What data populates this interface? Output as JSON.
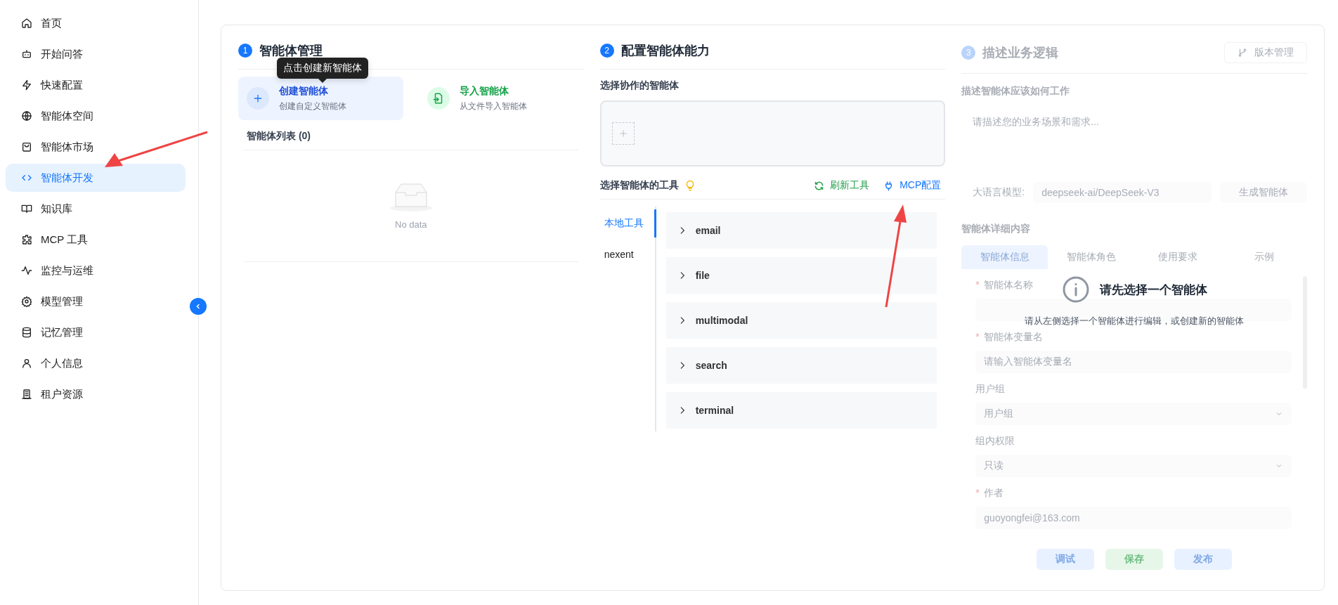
{
  "sidebar": {
    "items": [
      {
        "label": "首页",
        "selected": false
      },
      {
        "label": "开始问答",
        "selected": false
      },
      {
        "label": "快速配置",
        "selected": false
      },
      {
        "label": "智能体空间",
        "selected": false
      },
      {
        "label": "智能体市场",
        "selected": false
      },
      {
        "label": "智能体开发",
        "selected": true
      },
      {
        "label": "知识库",
        "selected": false
      },
      {
        "label": "MCP 工具",
        "selected": false
      },
      {
        "label": "监控与运维",
        "selected": false
      },
      {
        "label": "模型管理",
        "selected": false
      },
      {
        "label": "记忆管理",
        "selected": false
      },
      {
        "label": "个人信息",
        "selected": false
      },
      {
        "label": "租户资源",
        "selected": false
      }
    ]
  },
  "agent_management": {
    "step": "1",
    "title": "智能体管理",
    "tooltip": "点击创建新智能体",
    "actions": [
      {
        "title": "创建智能体",
        "subtitle": "创建自定义智能体",
        "kind": "create",
        "highlighted": true
      },
      {
        "title": "导入智能体",
        "subtitle": "从文件导入智能体",
        "kind": "import",
        "highlighted": false
      }
    ],
    "list_title": "智能体列表 (0)",
    "empty_text": "No data"
  },
  "capabilities": {
    "step": "2",
    "title": "配置智能体能力",
    "collaborators_label": "选择协作的智能体",
    "tools_label": "选择智能体的工具",
    "refresh_button": "刷新工具",
    "mcp_button": "MCP配置",
    "tool_tabs": [
      {
        "label": "本地工具",
        "selected": true
      },
      {
        "label": "nexent",
        "selected": false
      }
    ],
    "tools": [
      {
        "name": "email",
        "expanded": false
      },
      {
        "name": "file",
        "expanded": false
      },
      {
        "name": "multimodal",
        "expanded": false
      },
      {
        "name": "search",
        "expanded": false
      },
      {
        "name": "terminal",
        "expanded": false
      }
    ]
  },
  "business_logic": {
    "disabled": true,
    "step": "3",
    "title": "描述业务逻辑",
    "version_button": "版本管理",
    "description_label": "描述智能体应该如何工作",
    "description_placeholder": "请描述您的业务场景和需求...",
    "model_label": "大语言模型:",
    "model_value": "deepseek-ai/DeepSeek-V3",
    "generate_button": "生成智能体",
    "details_label": "智能体详细内容",
    "detail_tabs": [
      {
        "label": "智能体信息",
        "selected": true
      },
      {
        "label": "智能体角色",
        "selected": false
      },
      {
        "label": "使用要求",
        "selected": false
      },
      {
        "label": "示例",
        "selected": false
      }
    ],
    "fields": [
      {
        "label": "智能体名称",
        "marker": "*",
        "kind": "input"
      },
      {
        "label": "智能体变量名",
        "marker": "*",
        "kind": "input",
        "placeholder": "请输入智能体变量名"
      },
      {
        "label": "用户组",
        "kind": "select",
        "placeholder": "用户组"
      },
      {
        "label": "组内权限",
        "kind": "select",
        "value": "只读"
      },
      {
        "label": "作者",
        "marker": "*",
        "kind": "input",
        "value": "guoyongfei@163.com"
      }
    ],
    "buttons": [
      {
        "label": "调试",
        "kind": "debug"
      },
      {
        "label": "保存",
        "kind": "save"
      },
      {
        "label": "发布",
        "kind": "publish"
      }
    ],
    "notice_title": "请先选择一个智能体",
    "notice_text": "请从左侧选择一个智能体进行编辑，或创建新的智能体"
  }
}
